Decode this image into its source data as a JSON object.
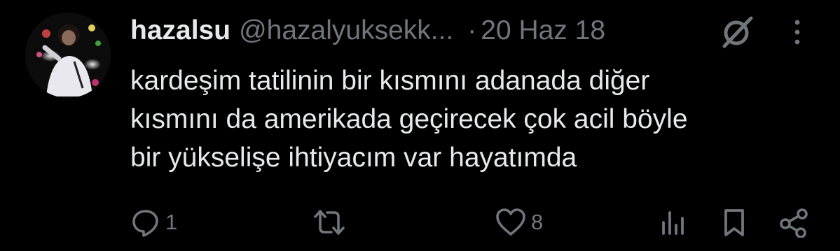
{
  "tweet": {
    "display_name": "hazalsu",
    "handle": "@hazalyuksekk...",
    "separator": "·",
    "date": "20 Haz 18",
    "text_lines": [
      "kardeşim tatilinin bir kısmını adanada diğer",
      "kısmını da amerikada geçirecek çok acil böyle",
      "bir yükselişe ihtiyacım var hayatımda"
    ]
  },
  "actions": {
    "reply": {
      "icon": "reply-icon",
      "count": "1"
    },
    "retweet": {
      "icon": "retweet-icon",
      "count": ""
    },
    "like": {
      "icon": "heart-icon",
      "count": "8"
    },
    "views": {
      "icon": "views-icon"
    },
    "bookmark": {
      "icon": "bookmark-icon"
    },
    "share": {
      "icon": "share-icon"
    }
  },
  "header_icons": {
    "grok": "grok-icon",
    "more": "more-vertical-icon"
  },
  "colors": {
    "background": "#000000",
    "primary_text": "#e7e9ea",
    "secondary_text": "#71767b"
  }
}
